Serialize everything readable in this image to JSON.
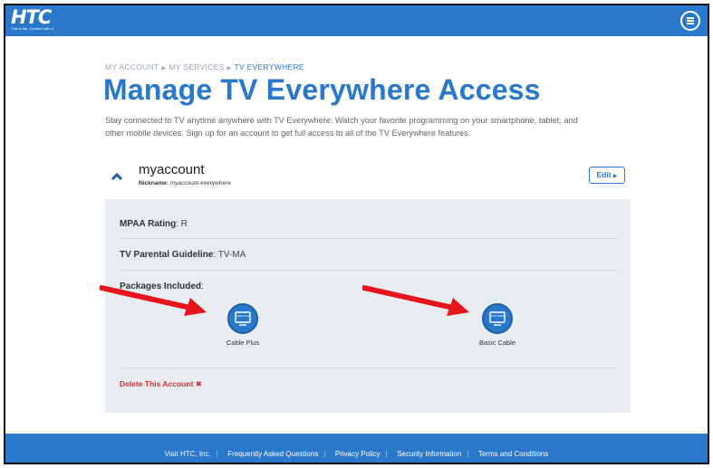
{
  "logo": {
    "text": "HTC",
    "tagline": "This is Me. Connect with it."
  },
  "breadcrumb": [
    "MY ACCOUNT",
    "MY SERVICES",
    "TV EVERYWHERE"
  ],
  "page": {
    "title": "Manage TV Everywhere Access",
    "description": "Stay connected to TV anytime anywhere with TV Everywhere. Watch your favorite programming on your smartphone, tablet, and other mobile devices. Sign up for an account to get full access to all of the TV Everywhere features."
  },
  "account": {
    "name": "myaccount",
    "nickname_label": "Nickname:",
    "nickname": "myaccount-everywhere",
    "edit_label": "Edit"
  },
  "details": {
    "mpaa_label": "MPAA Rating",
    "mpaa_value": "R",
    "parental_label": "TV Parental Guideline",
    "parental_value": "TV-MA",
    "packages_label": "Packages Included"
  },
  "packages": [
    {
      "name": "Cable Plus",
      "icon_text": "CABLE PLUS"
    },
    {
      "name": "Basic Cable",
      "icon_text": "BASIC CABLE"
    }
  ],
  "delete_label": "Delete This Account",
  "footer": [
    "Visit HTC, Inc.",
    "Frequently Asked Questions",
    "Privacy Policy",
    "Security Information",
    "Terms and Conditions"
  ],
  "colors": {
    "brand": "#2a78cc",
    "panel": "#e9edf1",
    "danger": "#d0303a",
    "arrow": "#e8141c"
  }
}
